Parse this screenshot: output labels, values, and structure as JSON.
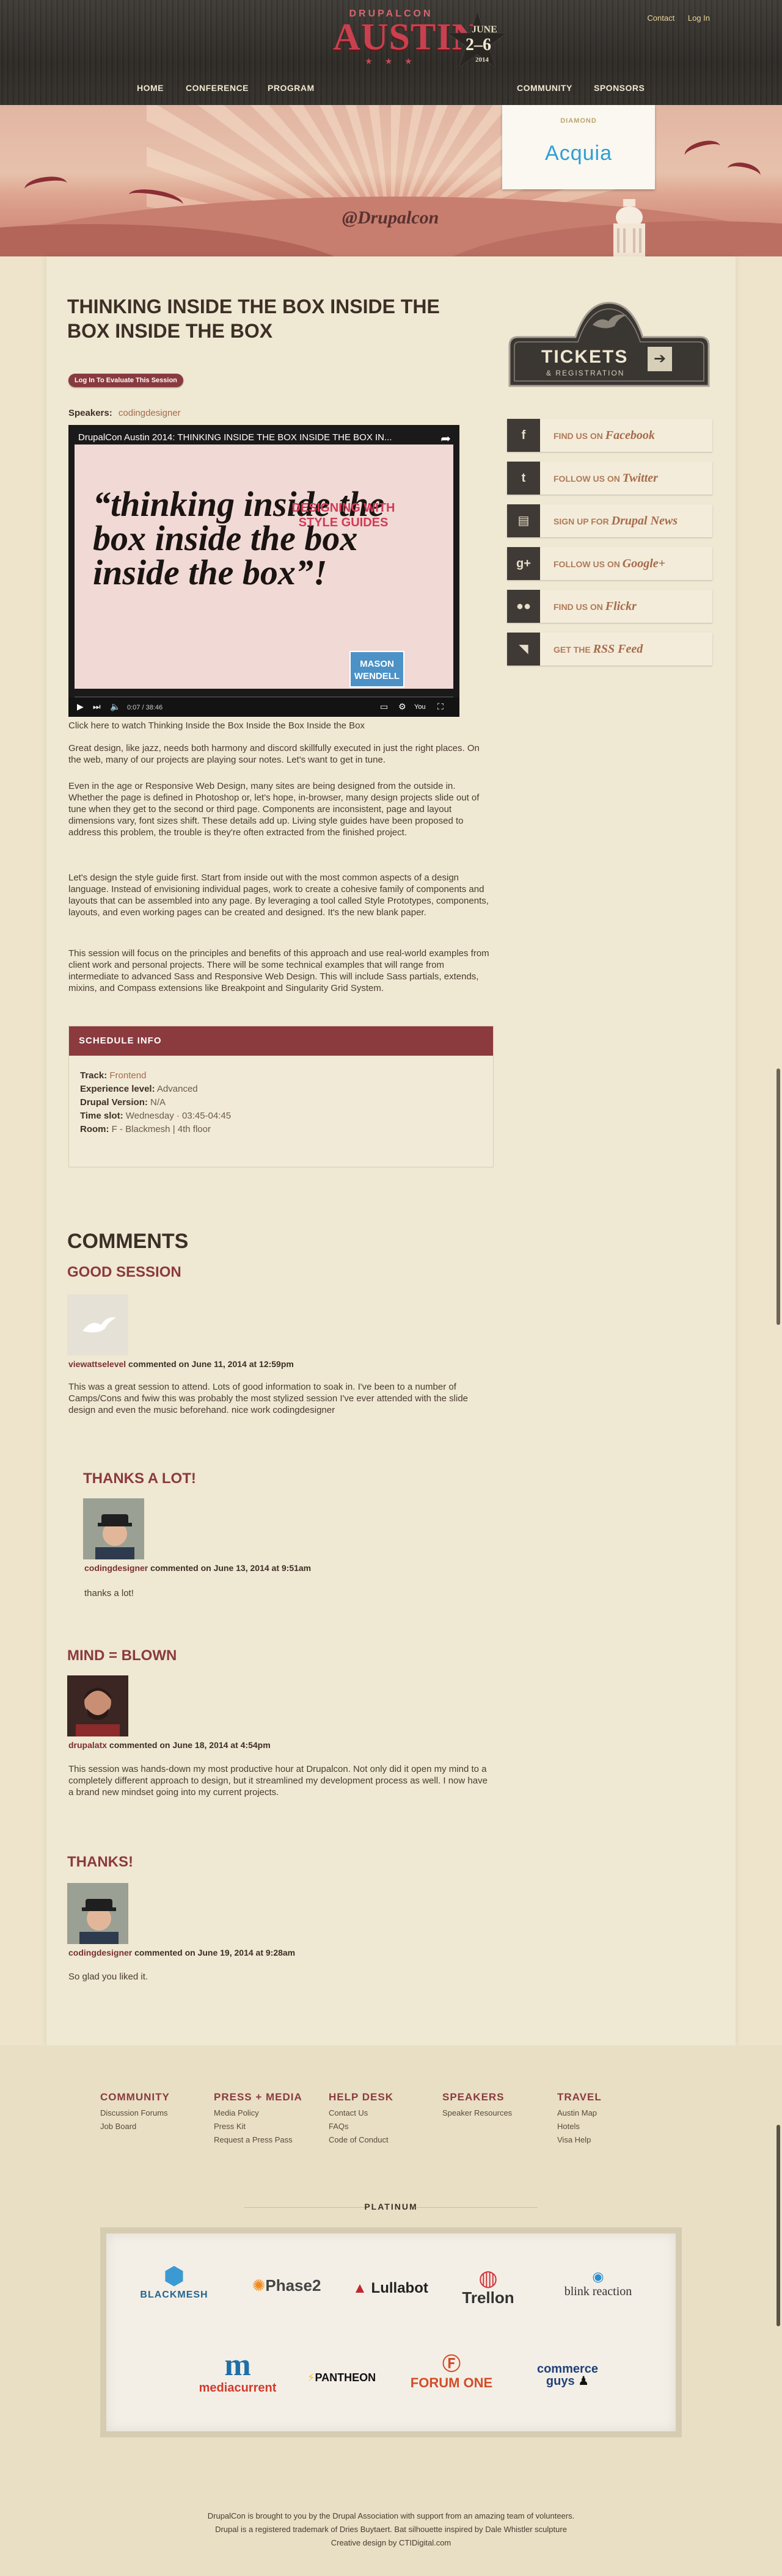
{
  "header": {
    "logo_small": "DRUPALCON",
    "logo_big": "AUSTIN",
    "logo_month": "JUNE",
    "logo_days": "2–6",
    "logo_year": "2014",
    "util_links": [
      "Contact",
      "Log In"
    ],
    "nav": [
      "HOME",
      "CONFERENCE",
      "PROGRAM",
      "COMMUNITY",
      "SPONSORS"
    ]
  },
  "hero": {
    "handle": "@Drupalcon",
    "sponsor_level": "DIAMOND",
    "sponsor_name": "Acquia"
  },
  "session": {
    "title": "THINKING INSIDE THE BOX INSIDE THE BOX INSIDE THE BOX",
    "evaluate_button": "Log In To Evaluate This Session",
    "speakers_label": "Speakers:",
    "speaker": "codingdesigner",
    "video": {
      "title": "DrupalCon Austin 2014: THINKING INSIDE THE BOX INSIDE THE BOX IN...",
      "quote": "“thinking inside the box inside the box inside the box”!",
      "side_title": "DESIGNING WITH STYLE GUIDES",
      "badge": "MASON WENDELL",
      "time": "0:07 / 38:46"
    },
    "caption": "Click here to watch Thinking Inside the Box Inside the Box Inside the Box",
    "paragraphs": [
      "Great design, like jazz, needs both harmony and discord skillfully executed in just the right places. On the web, many of our projects are playing sour notes. Let's want to get in tune.",
      "Even in the age or Responsive Web Design, many sites are being designed from the outside in. Whether the page is defined in Photoshop or, let's hope, in-browser, many design projects slide out of tune when they get to the second or third page. Components are inconsistent, page and layout dimensions vary, font sizes shift. These details add up. Living style guides have been proposed to address this problem, the trouble is they're often extracted from the finished project.",
      "Let's design the style guide first. Start from inside out with the most common aspects of a design language. Instead of envisioning individual pages, work to create a cohesive family of components and layouts that can be assembled into any page. By leveraging a tool called Style Prototypes, components, layouts, and even working pages can be created and designed. It's the new blank paper.",
      "This session will focus on the principles and benefits of this approach and use real-world examples from client work and personal projects. There will be some technical examples that will range from intermediate to advanced Sass and Responsive Web Design. This will include Sass partials, extends, mixins, and Compass extensions like Breakpoint and Singularity Grid System."
    ],
    "schedule": {
      "heading": "SCHEDULE INFO",
      "rows": [
        {
          "label": "Track:",
          "value": "Frontend"
        },
        {
          "label": "Experience level:",
          "value": "Advanced"
        },
        {
          "label": "Drupal Version:",
          "value": "N/A"
        },
        {
          "label": "Time slot:",
          "value": "Wednesday · 03:45-04:45"
        },
        {
          "label": "Room:",
          "value": "F - Blackmesh | 4th floor"
        }
      ]
    }
  },
  "comments": {
    "heading": "COMMENTS",
    "items": [
      {
        "title": "GOOD SESSION",
        "user": "viewattselevel",
        "meta": " commented on June 11, 2014 at 12:59pm",
        "text": "This was a great session to attend. Lots of good information to soak in. I've been to a number of Camps/Cons and fwiw this was probably the most stylized session I've ever attended with the slide design and even the music beforehand. nice work codingdesigner"
      },
      {
        "title": "THANKS A LOT!",
        "user": "codingdesigner",
        "meta": " commented on June 13, 2014 at 9:51am",
        "text": "thanks a lot!"
      },
      {
        "title": "MIND = BLOWN",
        "user": "drupalatx",
        "meta": " commented on June 18, 2014 at 4:54pm",
        "text": "This session was hands-down my most productive hour at Drupalcon. Not only did it open my mind to a completely different approach to design, but it streamlined my development process as well. I now have a brand new mindset going into my current projects."
      },
      {
        "title": "THANKS!",
        "user": "codingdesigner",
        "meta": " commented on June 19, 2014 at 9:28am",
        "text": "So glad you liked it."
      }
    ]
  },
  "sidebar": {
    "tickets_line1": "TICKETS",
    "tickets_line2": "& REGISTRATION",
    "social": [
      {
        "icon": "f",
        "prefix": "FIND US ON ",
        "name": "Facebook"
      },
      {
        "icon": "t",
        "prefix": "FOLLOW US ON ",
        "name": "Twitter"
      },
      {
        "icon": "▤",
        "prefix": "SIGN UP FOR ",
        "name": "Drupal News"
      },
      {
        "icon": "g+",
        "prefix": "FOLLOW US ON ",
        "name": "Google+"
      },
      {
        "icon": "●●",
        "prefix": "FIND US ON ",
        "name": "Flickr"
      },
      {
        "icon": "◥",
        "prefix": "GET THE ",
        "name": "RSS Feed"
      }
    ]
  },
  "footer": {
    "columns": [
      {
        "heading": "COMMUNITY",
        "links": [
          "Discussion Forums",
          "Job Board"
        ]
      },
      {
        "heading": "PRESS + MEDIA",
        "links": [
          "Media Policy",
          "Press Kit",
          "Request a Press Pass"
        ]
      },
      {
        "heading": "HELP DESK",
        "links": [
          "Contact Us",
          "FAQs",
          "Code of Conduct"
        ]
      },
      {
        "heading": "SPEAKERS",
        "links": [
          "Speaker Resources"
        ]
      },
      {
        "heading": "TRAVEL",
        "links": [
          "Austin Map",
          "Hotels",
          "Visa Help"
        ]
      }
    ],
    "platinum_label": "PLATINUM",
    "sponsors": [
      "BLACKMESH",
      "Phase2",
      "Lullabot",
      "Trellon",
      "blink reaction",
      "mediacurrent",
      "PANTHEON",
      "FORUM ONE",
      "commerce guys"
    ],
    "credits": [
      "DrupalCon is brought to you by the Drupal Association with support from an amazing team of volunteers.",
      "Drupal is a registered trademark of Dries Buytaert. Bat silhouette inspired by Dale Whistler sculpture",
      "Creative design by CTIDigital.com"
    ]
  },
  "colors": {
    "accent": "#8b3a3e",
    "paper": "#efe8d3",
    "topbar": "#2f2c28",
    "link": "#a36c4e"
  }
}
